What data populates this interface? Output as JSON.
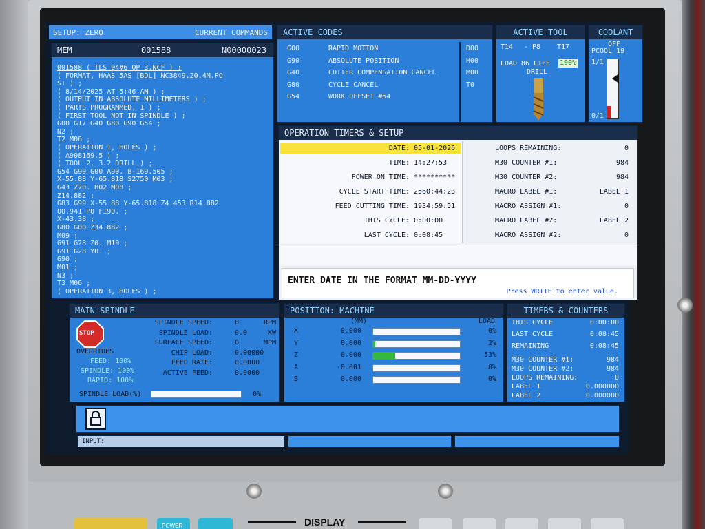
{
  "header": {
    "setup": "SETUP: ZERO",
    "current_commands": "CURRENT COMMANDS"
  },
  "program": {
    "mode": "MEM",
    "number": "001588",
    "line": "N00000023",
    "lines": [
      "001588 ( TLS 04#6 OP 3.NCF ) ;",
      "( FORMAT, HAAS 5AS [BDL] NC3849.20.4M.PO",
      "ST ) ;",
      "( 8/14/2025 AT 5:46 AM ) ;",
      "( OUTPUT IN ABSOLUTE MILLIMETERS ) ;",
      "( PARTS PROGRAMMED, 1 ) ;",
      "( FIRST TOOL NOT IN SPINDLE ) ;",
      "G00 G17 G40 G80 G90 G54 ;",
      "N2 ;",
      "T2 M06 ;",
      "( OPERATION 1, HOLES ) ;",
      "( A908169.5 ) ;",
      "( TOOL 2, 3.2 DRILL ) ;",
      "G54 G90 G00 A90. B-169.505 ;",
      "X-55.88 Y-65.818 S2750 M03 ;",
      "G43 Z70. H02 M08 ;",
      "Z14.882 ;",
      "G83 G99 X-55.88 Y-65.818 Z4.453 R14.882",
      "Q0.941 P0 F190. ;",
      "X-43.38 ;",
      "G80 G00 Z34.882 ;",
      "M09 ;",
      "G91 G28 Z0. M19 ;",
      "G91 G28 Y0. ;",
      "G90 ;",
      "M01 ;",
      "N3 ;",
      "T3 M06 ;",
      "( OPERATION 3, HOLES ) ;"
    ]
  },
  "active_codes": {
    "title": "ACTIVE CODES",
    "codes": [
      {
        "code": "G00",
        "desc": "RAPID MOTION"
      },
      {
        "code": "G90",
        "desc": "ABSOLUTE POSITION"
      },
      {
        "code": "G40",
        "desc": "CUTTER COMPENSATION CANCEL"
      },
      {
        "code": "G80",
        "desc": "CYCLE CANCEL"
      },
      {
        "code": "G54",
        "desc": "WORK OFFSET #54"
      }
    ],
    "right": [
      "D00",
      "H00",
      "M00",
      "T0"
    ]
  },
  "active_tool": {
    "title": "ACTIVE TOOL",
    "t": "T14",
    "p": "- P8",
    "t2": "T17",
    "load": "LOAD",
    "load_val": "86",
    "life": "LIFE",
    "life_val": "100%",
    "type": "DRILL"
  },
  "coolant": {
    "title": "COOLANT",
    "state": "OFF",
    "pcool": "PCOOL 19",
    "top": "1/1",
    "bottom": "0/1"
  },
  "timers": {
    "title": "OPERATION TIMERS & SETUP",
    "rows": [
      {
        "label": "DATE:",
        "value": "05-01-2026"
      },
      {
        "label": "TIME:",
        "value": "14:27:53"
      },
      {
        "label": "POWER ON TIME:",
        "value": "**********"
      },
      {
        "label": "CYCLE START TIME:",
        "value": "2560:44:23"
      },
      {
        "label": "FEED CUTTING TIME:",
        "value": "1934:59:51"
      },
      {
        "label": "THIS CYCLE:",
        "value": "0:00:00"
      },
      {
        "label": "LAST CYCLE:",
        "value": "0:08:45"
      }
    ],
    "right_rows": [
      {
        "label": "LOOPS REMAINING:",
        "value": "0"
      },
      {
        "label": "M30 COUNTER #1:",
        "value": "984"
      },
      {
        "label": "M30 COUNTER #2:",
        "value": "984"
      },
      {
        "label": "MACRO LABEL #1:",
        "value": "LABEL 1"
      },
      {
        "label": "MACRO ASSIGN #1:",
        "value": "0"
      },
      {
        "label": "MACRO LABEL #2:",
        "value": "LABEL 2"
      },
      {
        "label": "MACRO ASSIGN #2:",
        "value": "0"
      }
    ],
    "prompt": "ENTER DATE IN THE FORMAT MM-DD-YYYY",
    "hint": "Press WRITE to enter value."
  },
  "spindle": {
    "title": "MAIN SPINDLE",
    "stop": "STOP",
    "overrides": "OVERRIDES",
    "feed": "FEED: 100%",
    "spindle": "SPINDLE: 100%",
    "rapid": "RAPID: 100%",
    "rows": [
      {
        "label": "SPINDLE SPEED:",
        "value": "0",
        "unit": "RPM"
      },
      {
        "label": "SPINDLE LOAD:",
        "value": "0.0",
        "unit": "KW"
      },
      {
        "label": "SURFACE SPEED:",
        "value": "0",
        "unit": "MPM"
      },
      {
        "label": "CHIP LOAD:",
        "value": "0.00000",
        "unit": ""
      },
      {
        "label": "FEED RATE:",
        "value": "0.0000",
        "unit": ""
      },
      {
        "label": "ACTIVE FEED:",
        "value": "0.0000",
        "unit": ""
      }
    ],
    "load_label": "SPINDLE LOAD(%)",
    "load_pct": "0%",
    "load_fraction": 0
  },
  "position": {
    "title": "POSITION: MACHINE",
    "unit": "(MM)",
    "load": "LOAD",
    "axes": [
      {
        "axis": "X",
        "value": "0.000",
        "load": "0%",
        "frac": 0
      },
      {
        "axis": "Y",
        "value": "0.000",
        "load": "2%",
        "frac": 0.02
      },
      {
        "axis": "Z",
        "value": "0.000",
        "load": "53%",
        "frac": 0.25
      },
      {
        "axis": "A",
        "value": "-0.001",
        "load": "0%",
        "frac": 0
      },
      {
        "axis": "B",
        "value": "0.000",
        "load": "0%",
        "frac": 0
      }
    ]
  },
  "counters": {
    "title": "TIMERS & COUNTERS",
    "rows": [
      {
        "label": "THIS CYCLE",
        "value": "0:00:00"
      },
      {
        "label": "LAST CYCLE",
        "value": "0:08:45"
      },
      {
        "label": "REMAINING",
        "value": "0:08:45"
      },
      {
        "label": "M30 COUNTER #1:",
        "value": "984"
      },
      {
        "label": "M30 COUNTER #2:",
        "value": "984"
      },
      {
        "label": "LOOPS REMAINING:",
        "value": "0"
      },
      {
        "label": "LABEL 1",
        "value": "0.000000"
      },
      {
        "label": "LABEL 2",
        "value": "0.000000"
      }
    ]
  },
  "input": {
    "label": "INPUT:"
  },
  "hardware": {
    "display": "DISPLAY",
    "power": "POWER"
  },
  "colors": {
    "panel": "#2b7fd8",
    "header": "#1a2d4a",
    "highlight": "#f7e33a",
    "load_fill": "#36b83a"
  }
}
